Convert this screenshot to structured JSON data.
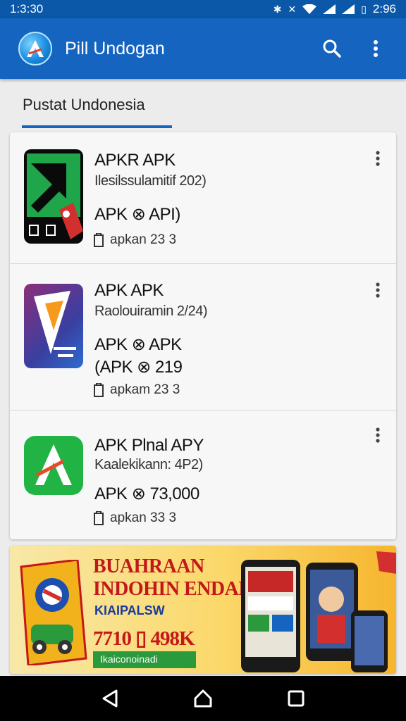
{
  "statusbar": {
    "time": "1:3:30",
    "clock": "2:96"
  },
  "appbar": {
    "title": "Pill Undogan"
  },
  "tabs": [
    {
      "label": "Pustat Undonesia"
    }
  ],
  "apps": [
    {
      "name": "APKR APK",
      "subtitle": "Ilesilssulamitif 202)",
      "meta": [
        "APK ⊗ API)"
      ],
      "size": "apkan 23 3"
    },
    {
      "name": "APK APK",
      "subtitle": "Raolouiramin 2/24)",
      "meta": [
        "APK ⊗ APK",
        "(APK ⊗ 219"
      ],
      "size": "apkam 23 3"
    },
    {
      "name": "APK Plnal APY",
      "subtitle": "Kaalekikann: 4P2)",
      "meta": [
        "APK ⊗ 73,000"
      ],
      "size": "apkan 33 3"
    }
  ],
  "banner": {
    "line1": "BUAHRAAN",
    "line2": "INDOHIN ENDAN",
    "line3": "KIAIPALSW",
    "price": "7710 ▯ 498K",
    "tag": "Ikaiconoinadi"
  },
  "colors": {
    "primary": "#1565c0",
    "status": "#0b57a8",
    "accent_red": "#c41818"
  },
  "icons": [
    "app-logo-icon",
    "search-icon",
    "more-vert-icon",
    "back-icon",
    "home-icon",
    "recents-icon"
  ]
}
